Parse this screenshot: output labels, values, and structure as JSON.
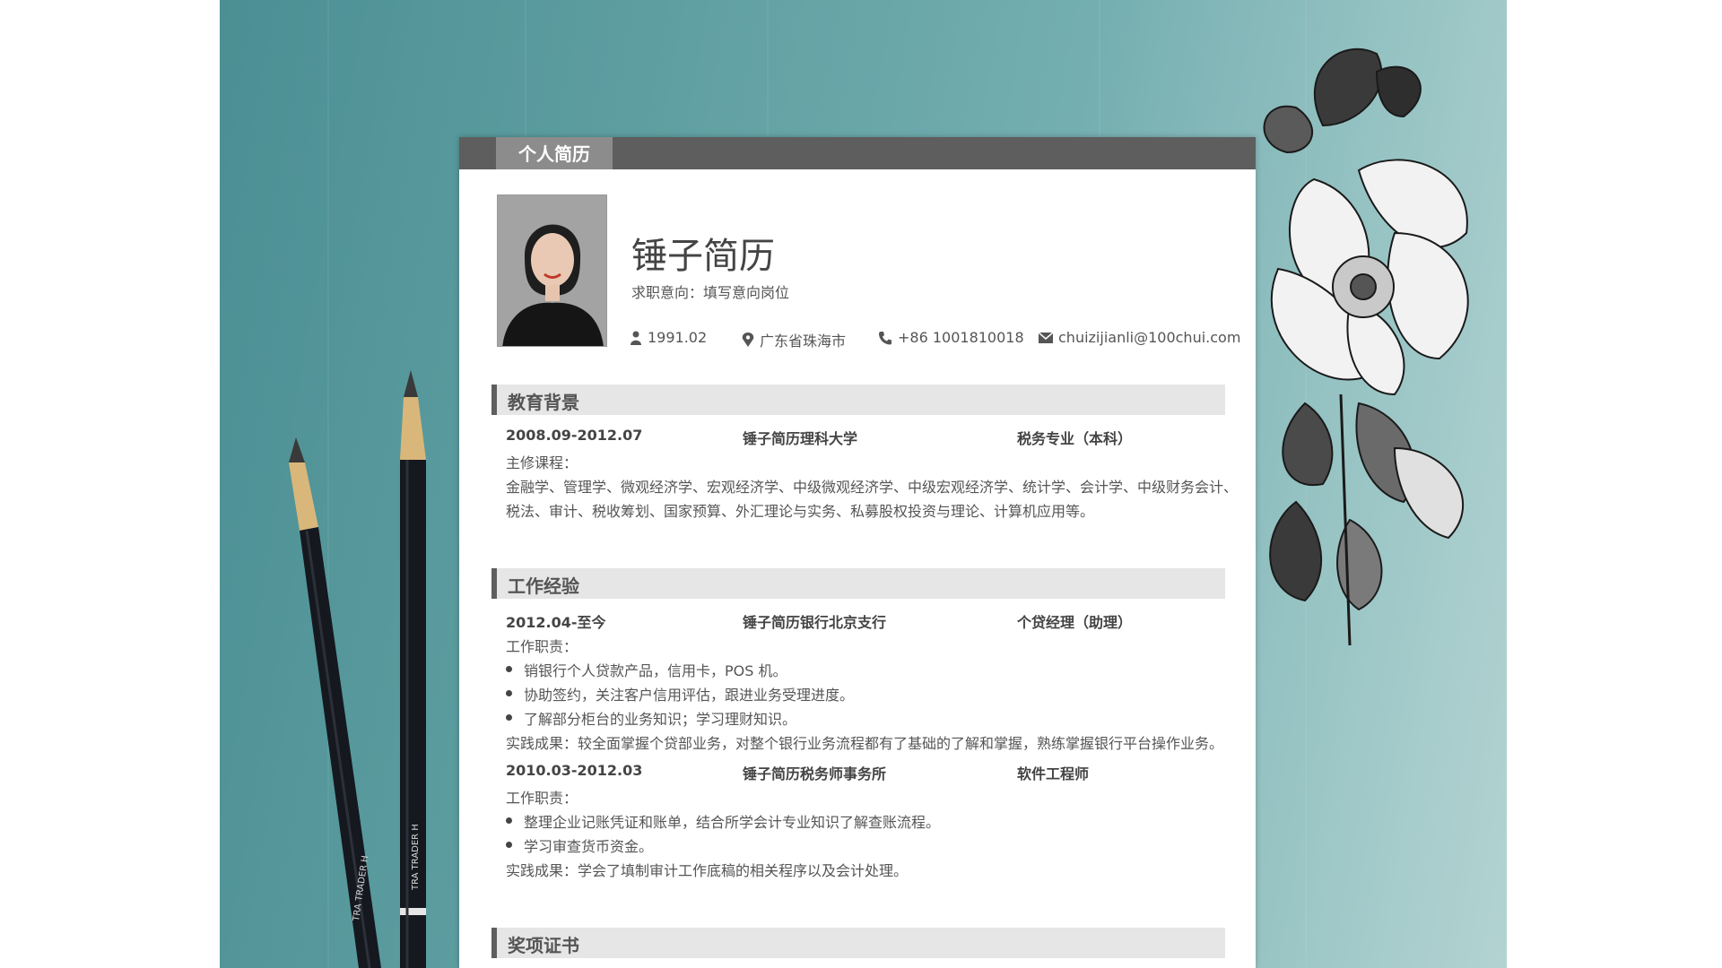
{
  "tab_label": "个人简历",
  "name": "锤子简历",
  "intent": "求职意向：填写意向岗位",
  "contacts": {
    "birth": "1991.02",
    "location": "广东省珠海市",
    "phone": "+86 1001810018",
    "email": "chuizijianli@100chui.com"
  },
  "education": {
    "title": "教育背景",
    "period": "2008.09-2012.07",
    "school": "锤子简历理科大学",
    "major": "税务专业（本科）",
    "courses_label": "主修课程：",
    "courses_line1": "金融学、管理学、微观经济学、宏观经济学、中级微观经济学、中级宏观经济学、统计学、会计学、中级财务会计、",
    "courses_line2": "税法、审计、税收筹划、国家预算、外汇理论与实务、私募股权投资与理论、计算机应用等。"
  },
  "work": {
    "title": "工作经验",
    "jobs": [
      {
        "period": "2012.04-至今",
        "company": "锤子简历银行北京支行",
        "position": "个贷经理（助理）",
        "duty_label": "工作职责：",
        "duties": [
          "销银行个人贷款产品，信用卡，POS 机。",
          "协助签约，关注客户信用评估，跟进业务受理进度。",
          "了解部分柜台的业务知识；学习理财知识。"
        ],
        "result": "实践成果：较全面掌握个贷部业务，对整个银行业务流程都有了基础的了解和掌握，熟练掌握银行平台操作业务。"
      },
      {
        "period": "2010.03-2012.03",
        "company": "锤子简历税务师事务所",
        "position": "软件工程师",
        "duty_label": "工作职责：",
        "duties": [
          "整理企业记账凭证和账单，结合所学会计专业知识了解查账流程。",
          "学习审查货币资金。"
        ],
        "result": "实践成果：学会了填制审计工作底稿的相关程序以及会计处理。"
      }
    ]
  },
  "awards": {
    "title": "奖项证书"
  },
  "pencil_text": "TRA TRADER H"
}
